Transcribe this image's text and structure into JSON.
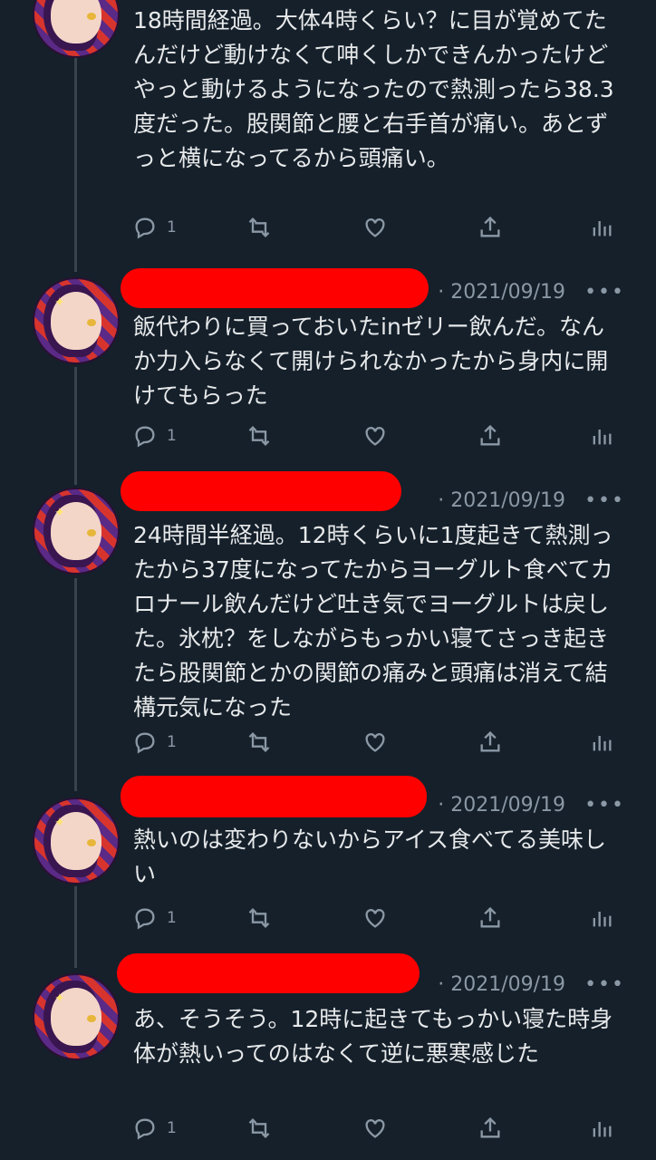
{
  "tweets": [
    {
      "date": "",
      "text": "18時間経過。大体4時くらい？に目が覚めてたんだけど動けなくて呻くしかできんかったけどやっと動けるようになったので熱測ったら38.3度だった。股関節と腰と右手首が痛い。あとずっと横になってるから頭痛い。",
      "reply_count": "1"
    },
    {
      "date": "2021/09/19",
      "text": "飯代わりに買っておいたinゼリー飲んだ。なんか力入らなくて開けられなかったから身内に開けてもらった",
      "reply_count": "1"
    },
    {
      "date": "2021/09/19",
      "text": "24時間半経過。12時くらいに1度起きて熱測ったから37度になってたからヨーグルト食べてカロナール飲んだけど吐き気でヨーグルトは戻した。氷枕？をしながらもっかい寝てさっき起きたら股関節とかの関節の痛みと頭痛は消えて結構元気になった",
      "reply_count": "1"
    },
    {
      "date": "2021/09/19",
      "text": "熱いのは変わりないからアイス食べてる美味しい",
      "reply_count": "1"
    },
    {
      "date": "2021/09/19",
      "text": "あ、そうそう。12時に起きてもっかい寝た時身体が熱いってのはなくて逆に悪寒感じた",
      "reply_count": "1"
    }
  ],
  "meta_separator": "·",
  "more_label": "•••",
  "icons": [
    "reply-icon",
    "retweet-icon",
    "like-icon",
    "share-icon",
    "analytics-icon"
  ],
  "colors": {
    "background": "#15202b",
    "text": "#e7e9ea",
    "muted": "#8b98a5",
    "redaction": "#ff0000"
  }
}
